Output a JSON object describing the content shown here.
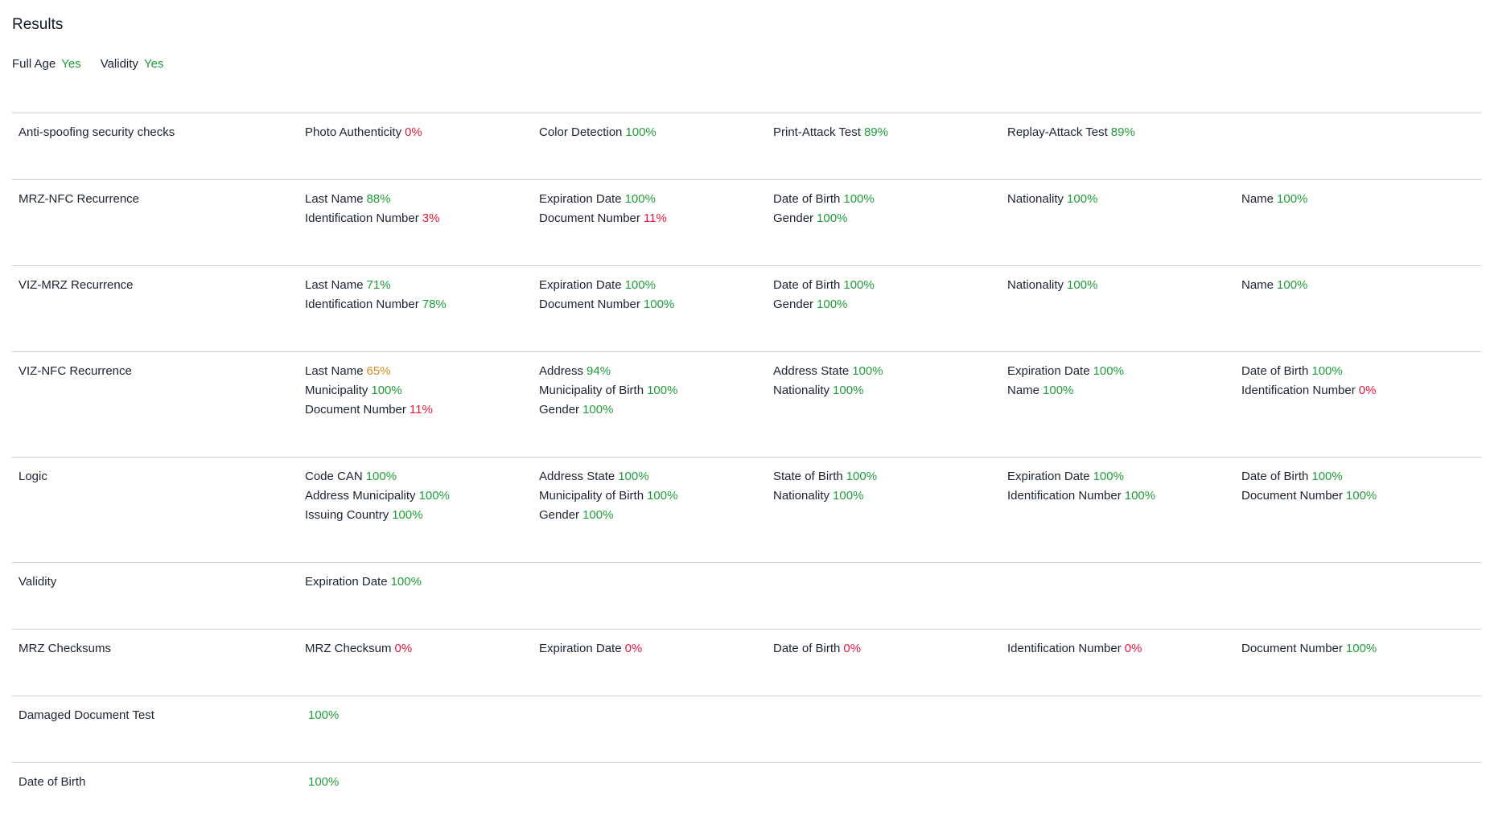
{
  "title": "Results",
  "summary": [
    {
      "label": "Full Age",
      "value": "Yes"
    },
    {
      "label": "Validity",
      "value": "Yes"
    }
  ],
  "colors": {
    "pass": "#1f9d3a",
    "fail": "#e5173f",
    "warn": "#d98a1a"
  },
  "rows": [
    {
      "label": "Anti-spoofing security checks",
      "cols": [
        [
          {
            "name": "Photo Authenticity",
            "pct": "0%",
            "status": "red"
          }
        ],
        [
          {
            "name": "Color Detection",
            "pct": "100%",
            "status": "green"
          }
        ],
        [
          {
            "name": "Print-Attack Test",
            "pct": "89%",
            "status": "green"
          }
        ],
        [
          {
            "name": "Replay-Attack Test",
            "pct": "89%",
            "status": "green"
          }
        ],
        []
      ]
    },
    {
      "label": "MRZ-NFC Recurrence",
      "cols": [
        [
          {
            "name": "Last Name",
            "pct": "88%",
            "status": "green"
          },
          {
            "name": "Identification Number",
            "pct": "3%",
            "status": "red"
          }
        ],
        [
          {
            "name": "Expiration Date",
            "pct": "100%",
            "status": "green"
          },
          {
            "name": "Document Number",
            "pct": "11%",
            "status": "red"
          }
        ],
        [
          {
            "name": "Date of Birth",
            "pct": "100%",
            "status": "green"
          },
          {
            "name": "Gender",
            "pct": "100%",
            "status": "green"
          }
        ],
        [
          {
            "name": "Nationality",
            "pct": "100%",
            "status": "green"
          }
        ],
        [
          {
            "name": "Name",
            "pct": "100%",
            "status": "green"
          }
        ]
      ]
    },
    {
      "label": "VIZ-MRZ Recurrence",
      "cols": [
        [
          {
            "name": "Last Name",
            "pct": "71%",
            "status": "green"
          },
          {
            "name": "Identification Number",
            "pct": "78%",
            "status": "green"
          }
        ],
        [
          {
            "name": "Expiration Date",
            "pct": "100%",
            "status": "green"
          },
          {
            "name": "Document Number",
            "pct": "100%",
            "status": "green"
          }
        ],
        [
          {
            "name": "Date of Birth",
            "pct": "100%",
            "status": "green"
          },
          {
            "name": "Gender",
            "pct": "100%",
            "status": "green"
          }
        ],
        [
          {
            "name": "Nationality",
            "pct": "100%",
            "status": "green"
          }
        ],
        [
          {
            "name": "Name",
            "pct": "100%",
            "status": "green"
          }
        ]
      ]
    },
    {
      "label": "VIZ-NFC Recurrence",
      "cols": [
        [
          {
            "name": "Last Name",
            "pct": "65%",
            "status": "orange"
          },
          {
            "name": "Municipality",
            "pct": "100%",
            "status": "green"
          },
          {
            "name": "Document Number",
            "pct": "11%",
            "status": "red"
          }
        ],
        [
          {
            "name": "Address",
            "pct": "94%",
            "status": "green"
          },
          {
            "name": "Municipality of Birth",
            "pct": "100%",
            "status": "green"
          },
          {
            "name": "Gender",
            "pct": "100%",
            "status": "green"
          }
        ],
        [
          {
            "name": "Address State",
            "pct": "100%",
            "status": "green"
          },
          {
            "name": "Nationality",
            "pct": "100%",
            "status": "green"
          }
        ],
        [
          {
            "name": "Expiration Date",
            "pct": "100%",
            "status": "green"
          },
          {
            "name": "Name",
            "pct": "100%",
            "status": "green"
          }
        ],
        [
          {
            "name": "Date of Birth",
            "pct": "100%",
            "status": "green"
          },
          {
            "name": "Identification Number",
            "pct": "0%",
            "status": "red"
          }
        ]
      ]
    },
    {
      "label": "Logic",
      "cols": [
        [
          {
            "name": "Code CAN",
            "pct": "100%",
            "status": "green"
          },
          {
            "name": "Address Municipality",
            "pct": "100%",
            "status": "green"
          },
          {
            "name": "Issuing Country",
            "pct": "100%",
            "status": "green"
          }
        ],
        [
          {
            "name": "Address State",
            "pct": "100%",
            "status": "green"
          },
          {
            "name": "Municipality of Birth",
            "pct": "100%",
            "status": "green"
          },
          {
            "name": "Gender",
            "pct": "100%",
            "status": "green"
          }
        ],
        [
          {
            "name": "State of Birth",
            "pct": "100%",
            "status": "green"
          },
          {
            "name": "Nationality",
            "pct": "100%",
            "status": "green"
          }
        ],
        [
          {
            "name": "Expiration Date",
            "pct": "100%",
            "status": "green"
          },
          {
            "name": "Identification Number",
            "pct": "100%",
            "status": "green"
          }
        ],
        [
          {
            "name": "Date of Birth",
            "pct": "100%",
            "status": "green"
          },
          {
            "name": "Document Number",
            "pct": "100%",
            "status": "green"
          }
        ]
      ]
    },
    {
      "label": "Validity",
      "cols": [
        [
          {
            "name": "Expiration Date",
            "pct": "100%",
            "status": "green"
          }
        ],
        [],
        [],
        [],
        []
      ]
    },
    {
      "label": "MRZ Checksums",
      "cols": [
        [
          {
            "name": "MRZ Checksum",
            "pct": "0%",
            "status": "red"
          }
        ],
        [
          {
            "name": "Expiration Date",
            "pct": "0%",
            "status": "red"
          }
        ],
        [
          {
            "name": "Date of Birth",
            "pct": "0%",
            "status": "red"
          }
        ],
        [
          {
            "name": "Identification Number",
            "pct": "0%",
            "status": "red"
          }
        ],
        [
          {
            "name": "Document Number",
            "pct": "100%",
            "status": "green"
          }
        ]
      ]
    },
    {
      "label": "Damaged Document Test",
      "value": {
        "pct": "100%",
        "status": "green"
      }
    },
    {
      "label": "Date of Birth",
      "value": {
        "pct": "100%",
        "status": "green"
      }
    }
  ]
}
